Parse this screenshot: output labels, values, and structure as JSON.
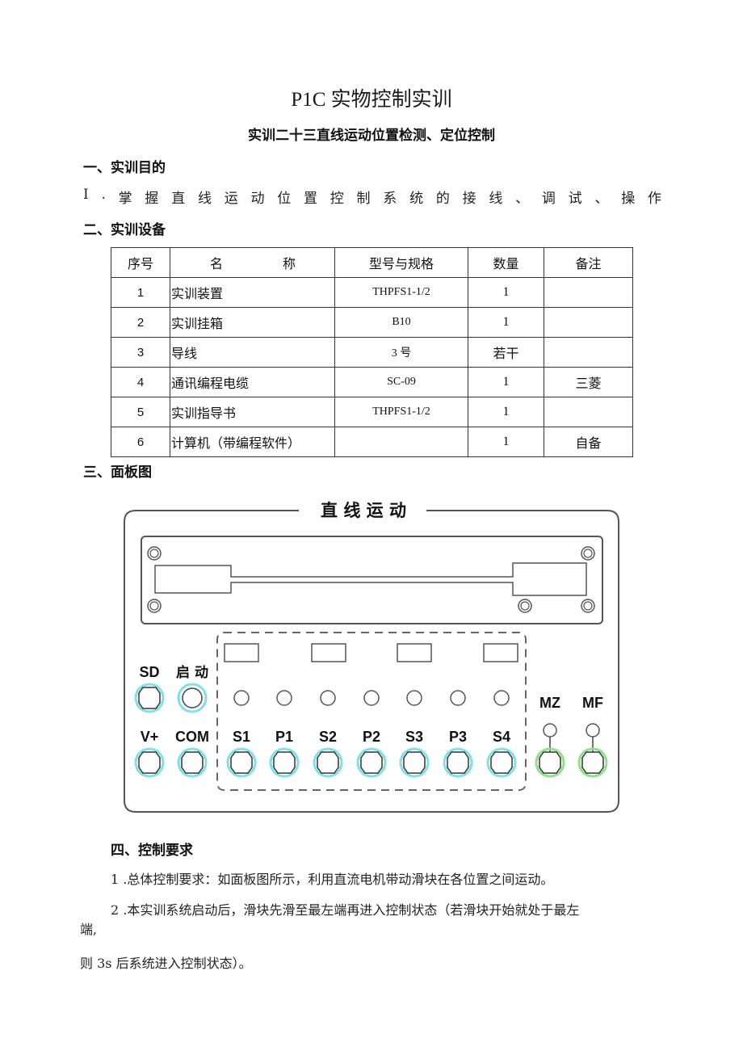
{
  "document": {
    "title": "P1C 实物控制实训",
    "subtitle": "实训二十三直线运动位置检测、定位控制"
  },
  "sections": {
    "objective": {
      "heading": "一、实训目的",
      "item_chars": [
        "I",
        ".",
        "掌",
        "握",
        "直",
        "线",
        "运",
        "动",
        "位",
        "置",
        "控",
        "制",
        "系",
        "统",
        "的",
        "接",
        "线",
        "、",
        "调",
        "试",
        "、",
        "操",
        "作"
      ]
    },
    "equipment": {
      "heading": "二、实训设备",
      "columns": {
        "no": "序号",
        "name_part1": "名",
        "name_part2": "称",
        "model": "型号与规格",
        "qty": "数量",
        "note": "备注"
      },
      "rows": [
        {
          "no": "1",
          "name": "实训装置",
          "model": "THPFS1-1/2",
          "qty": "1",
          "note": ""
        },
        {
          "no": "2",
          "name": "实训挂箱",
          "model": "B10",
          "qty": "1",
          "note": ""
        },
        {
          "no": "3",
          "name": "导线",
          "model": "3 号",
          "qty": "若干",
          "note": ""
        },
        {
          "no": "4",
          "name": "通讯编程电缆",
          "model": "SC-09",
          "qty": "1",
          "note": "三菱"
        },
        {
          "no": "5",
          "name": "实训指导书",
          "model": "THPFS1-1/2",
          "qty": "1",
          "note": ""
        },
        {
          "no": "6",
          "name": "计算机（带编程软件）",
          "model": "",
          "qty": "1",
          "note": "自备"
        }
      ]
    },
    "panel": {
      "heading": "三、面板图",
      "title": "直 线 运 动",
      "left_labels": {
        "sd": "SD",
        "start": "启 动",
        "vplus": "V+",
        "com": "COM"
      },
      "terminals": [
        "S1",
        "P1",
        "S2",
        "P2",
        "S3",
        "P3",
        "S4"
      ],
      "motor_labels": [
        "MZ",
        "MF"
      ],
      "colors": {
        "cyan_ring": "#7fe0e8",
        "green_ring": "#8fe08a",
        "line": "#555555"
      }
    },
    "control": {
      "heading": "四、控制要求",
      "p1": "1 .总体控制要求：如面板图所示，利用直流电机带动滑块在各位置之间运动。",
      "p2_line1": "2 .本实训系统启动后，滑块先滑至最左端再进入控制状态（若滑块开始就处于最左",
      "p2_line2": "端,",
      "p2_line3": "则 3s 后系统进入控制状态）。"
    }
  }
}
